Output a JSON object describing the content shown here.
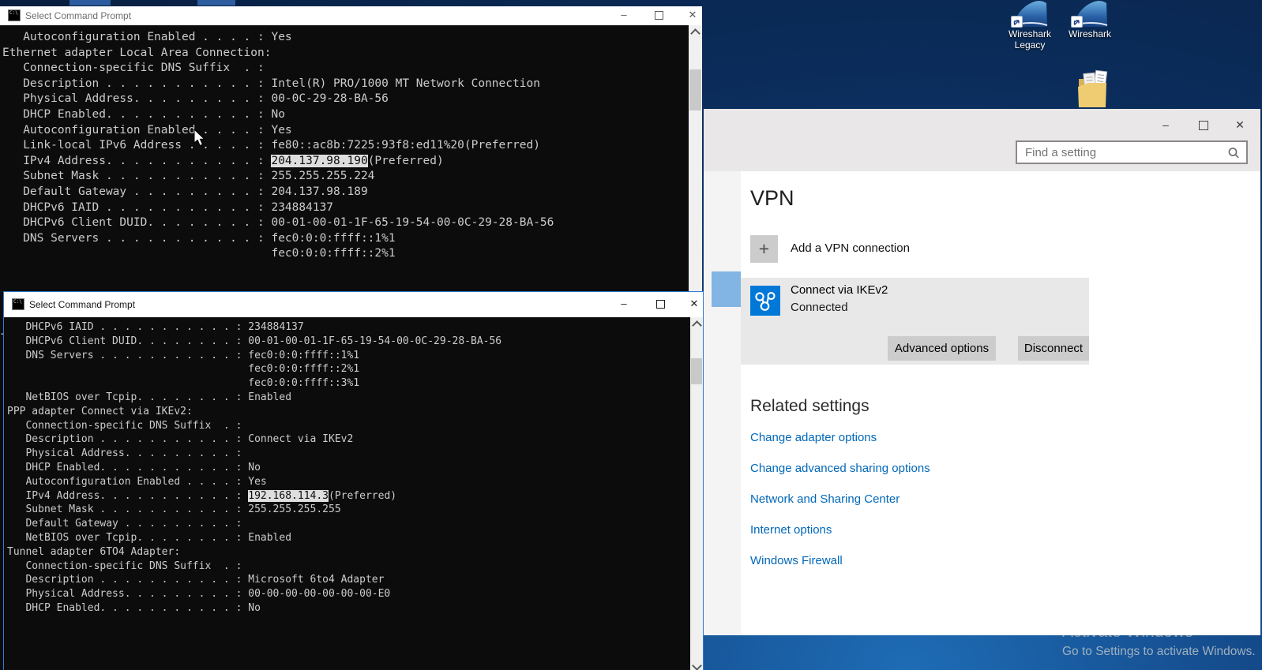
{
  "desktop": {
    "icons": [
      {
        "label": "Wireshark Legacy"
      },
      {
        "label": "Wireshark"
      }
    ],
    "watermark": {
      "line1": "Activate Windows",
      "line2": "Go to Settings to activate Windows."
    }
  },
  "glyphs": {
    "minimize": "–",
    "close": "✕",
    "plus": "+"
  },
  "terminal1": {
    "title": "Select Command Prompt",
    "lines": [
      "   Autoconfiguration Enabled . . . . : Yes",
      "",
      "Ethernet adapter Local Area Connection:",
      "",
      "   Connection-specific DNS Suffix  . :",
      "   Description . . . . . . . . . . . : Intel(R) PRO/1000 MT Network Connection",
      "   Physical Address. . . . . . . . . : 00-0C-29-28-BA-56",
      "   DHCP Enabled. . . . . . . . . . . : No",
      "   Autoconfiguration Enabled . . . . : Yes",
      "   Link-local IPv6 Address . . . . . : fe80::ac8b:7225:93f8:ed11%20(Preferred)",
      [
        "   IPv4 Address. . . . . . . . . . . : ",
        {
          "hl": "204.137.98.190"
        },
        "(Preferred)"
      ],
      "   Subnet Mask . . . . . . . . . . . : 255.255.255.224",
      "   Default Gateway . . . . . . . . . : 204.137.98.189",
      "   DHCPv6 IAID . . . . . . . . . . . : 234884137",
      "   DHCPv6 Client DUID. . . . . . . . : 00-01-00-01-1F-65-19-54-00-0C-29-28-BA-56",
      "   DNS Servers . . . . . . . . . . . : fec0:0:0:ffff::1%1",
      "                                       fec0:0:0:ffff::2%1"
    ]
  },
  "terminal2": {
    "title": "Select Command Prompt",
    "lines": [
      "   DHCPv6 IAID . . . . . . . . . . . : 234884137",
      "   DHCPv6 Client DUID. . . . . . . . : 00-01-00-01-1F-65-19-54-00-0C-29-28-BA-56",
      "   DNS Servers . . . . . . . . . . . : fec0:0:0:ffff::1%1",
      "                                       fec0:0:0:ffff::2%1",
      "                                       fec0:0:0:ffff::3%1",
      "   NetBIOS over Tcpip. . . . . . . . : Enabled",
      "",
      "PPP adapter Connect via IKEv2:",
      "",
      "   Connection-specific DNS Suffix  . :",
      "   Description . . . . . . . . . . . : Connect via IKEv2",
      "   Physical Address. . . . . . . . . :",
      "   DHCP Enabled. . . . . . . . . . . : No",
      "   Autoconfiguration Enabled . . . . : Yes",
      [
        "   IPv4 Address. . . . . . . . . . . : ",
        {
          "hl": "192.168.114.3"
        },
        "(Preferred)"
      ],
      "   Subnet Mask . . . . . . . . . . . : 255.255.255.255",
      "   Default Gateway . . . . . . . . . :",
      "   NetBIOS over Tcpip. . . . . . . . : Enabled",
      "",
      "Tunnel adapter 6TO4 Adapter:",
      "",
      "   Connection-specific DNS Suffix  . :",
      "   Description . . . . . . . . . . . : Microsoft 6to4 Adapter",
      "   Physical Address. . . . . . . . . : 00-00-00-00-00-00-00-E0",
      "   DHCP Enabled. . . . . . . . . . . : No"
    ]
  },
  "settings": {
    "search_placeholder": "Find a setting",
    "page_title": "VPN",
    "add_vpn_label": "Add a VPN connection",
    "vpn_item": {
      "name": "Connect via IKEv2",
      "status": "Connected"
    },
    "buttons": {
      "advanced": "Advanced options",
      "disconnect": "Disconnect"
    },
    "related": {
      "heading": "Related settings",
      "links": [
        "Change adapter options",
        "Change advanced sharing options",
        "Network and Sharing Center",
        "Internet options",
        "Windows Firewall"
      ]
    }
  },
  "colors": {
    "accent": "#0078d7",
    "link": "#0067b8",
    "nav_highlight": "#82b5e3",
    "selection_bg": "#dedede",
    "terminal_text": "#cccccc"
  }
}
